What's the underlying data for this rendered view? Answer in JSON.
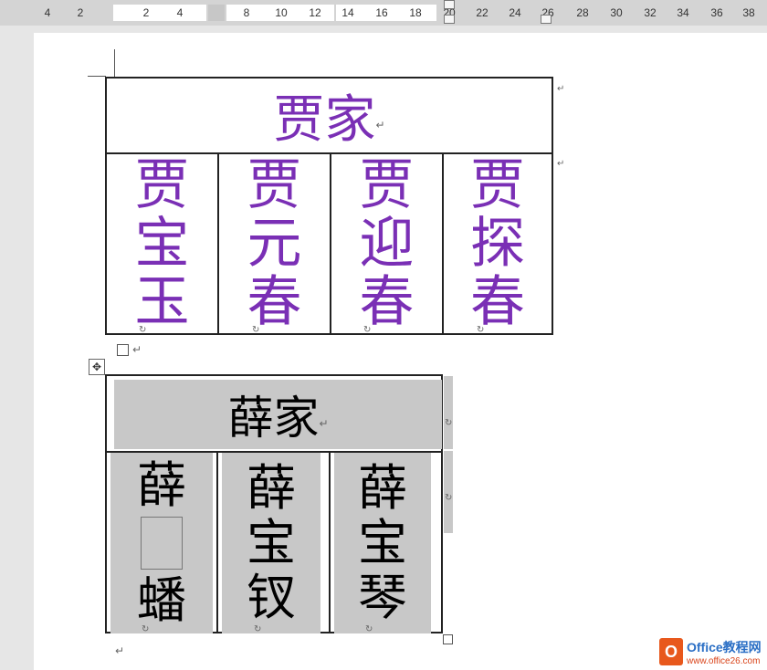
{
  "ruler": {
    "numbers": [
      "4",
      "2",
      "2",
      "4",
      "8",
      "10",
      "12",
      "14",
      "16",
      "18",
      "20",
      "22",
      "24",
      "26",
      "28",
      "30",
      "32",
      "34",
      "36",
      "38"
    ]
  },
  "table1": {
    "header": "贾家",
    "columns": [
      [
        "贾",
        "宝",
        "玉"
      ],
      [
        "贾",
        "元",
        "春"
      ],
      [
        "贾",
        "迎",
        "春"
      ],
      [
        "贾",
        "探",
        "春"
      ]
    ],
    "text_color": "#7a2fb5"
  },
  "table2": {
    "header": "薛家",
    "columns": [
      [
        "薛",
        "",
        "蟠"
      ],
      [
        "薛",
        "宝",
        "钗"
      ],
      [
        "薛",
        "宝",
        "琴"
      ]
    ],
    "shade_color": "#c8c8c8"
  },
  "marks": {
    "paragraph": "↵",
    "cell_end": "↻",
    "move_handle": "✥"
  },
  "logo": {
    "letter": "O",
    "name": "Office教程网",
    "url": "www.office26.com"
  }
}
